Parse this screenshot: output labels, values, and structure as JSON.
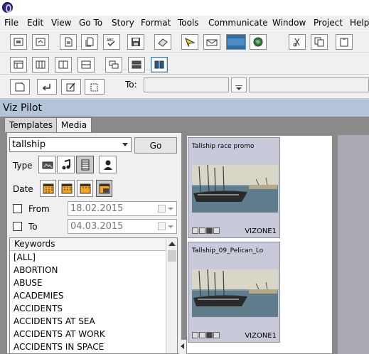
{
  "menu": {
    "items": [
      "File",
      "Edit",
      "View",
      "Go To",
      "Story",
      "Format",
      "Tools",
      "Communicate",
      "Window",
      "Project",
      "Help"
    ]
  },
  "toolbar": {
    "to_label": "To:",
    "to_value": "",
    "to_value2": ""
  },
  "panel": {
    "title": "Viz Pilot",
    "tabs": [
      {
        "label": "Templates",
        "active": false
      },
      {
        "label": "Media",
        "active": true
      }
    ]
  },
  "search": {
    "query": "tallship",
    "go_label": "Go",
    "type_label": "Type",
    "type_options": [
      "image-icon",
      "audio-icon",
      "video-icon",
      "person-icon"
    ],
    "type_selected": "video-icon",
    "date_label": "Date",
    "date_selected_index": 3
  },
  "date_filters": {
    "from_label": "From",
    "from_value": "18.02.2015",
    "from_checked": false,
    "to_label": "To",
    "to_value": "04.03.2015",
    "to_checked": false
  },
  "keywords": {
    "header": "Keywords",
    "items": [
      "[ALL]",
      "ABORTION",
      "ABUSE",
      "ACADEMIES",
      "ACCIDENTS",
      "ACCIDENTS AT SEA",
      "ACCIDENTS AT WORK",
      "ACCIDENTS IN SPACE"
    ]
  },
  "results": [
    {
      "title": "Tallship race promo",
      "source": "VIZONE1",
      "media_type": "video"
    },
    {
      "title": "Tallship_09_Pelican_Lo",
      "source": "VIZONE1",
      "media_type": "video"
    }
  ],
  "colors": {
    "panel_title_bg": "#b4c4d8",
    "card_bg": "#c8cad9",
    "active_toolbar_border": "#3c7fb1"
  }
}
